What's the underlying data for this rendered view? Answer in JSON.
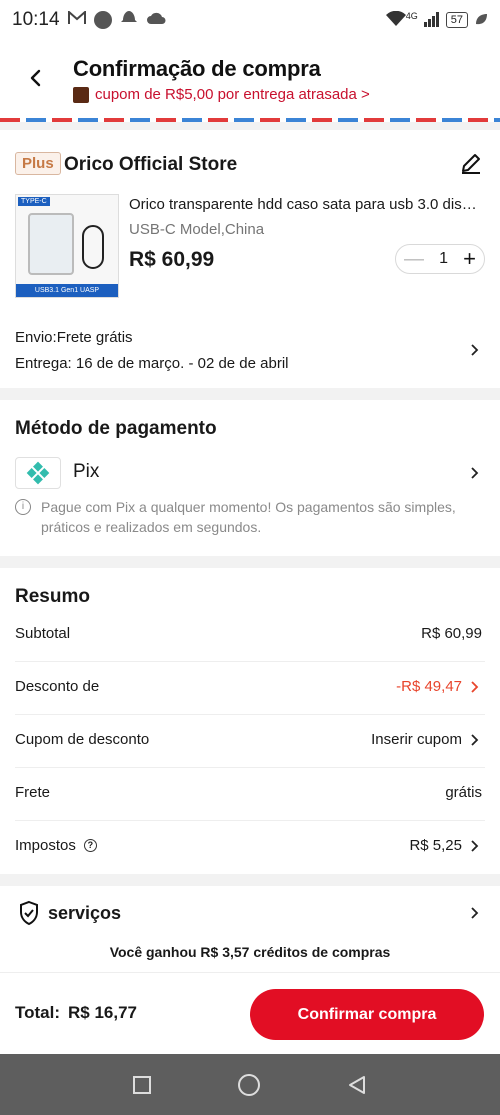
{
  "status_bar": {
    "time": "10:14",
    "battery": "57",
    "network": "4G"
  },
  "header": {
    "title": "Confirmação de compra",
    "promo": "cupom de R$5,00 por entrega atrasada >"
  },
  "store": {
    "badge": "Plus",
    "name": "Orico Official Store",
    "thumb_tag": "TYPE-C",
    "thumb_footer": "USB3.1 Gen1 UASP",
    "product_title": "Orico transparente hdd caso sata para usb 3.0 dis…",
    "variant": "USB-C Model,China",
    "price": "R$ 60,99",
    "quantity": "1",
    "shipping": "Envio:Frete grátis",
    "delivery": "Entrega: 16 de de março. - 02 de de abril"
  },
  "payment": {
    "title": "Método de pagamento",
    "method": "Pix",
    "note": "Pague com Pix a qualquer momento! Os pagamentos são simples, práticos e realizados em segundos."
  },
  "summary": {
    "title": "Resumo",
    "rows": [
      {
        "label": "Subtotal",
        "value": "R$ 60,99"
      },
      {
        "label": "Desconto de",
        "value": "-R$ 49,47"
      },
      {
        "label": "Cupom de desconto",
        "value": "Inserir cupom"
      },
      {
        "label": "Frete",
        "value": "grátis"
      },
      {
        "label": "Impostos",
        "value": "R$ 5,25"
      }
    ]
  },
  "services": {
    "title": "serviços",
    "credit": "Você ganhou R$ 3,57 créditos de compras"
  },
  "footer": {
    "total_label": "Total:",
    "total_value": "R$ 16,77",
    "confirm_label": "Confirmar compra"
  },
  "colors": {
    "accent": "#e20e24",
    "discount": "#e8452c"
  }
}
